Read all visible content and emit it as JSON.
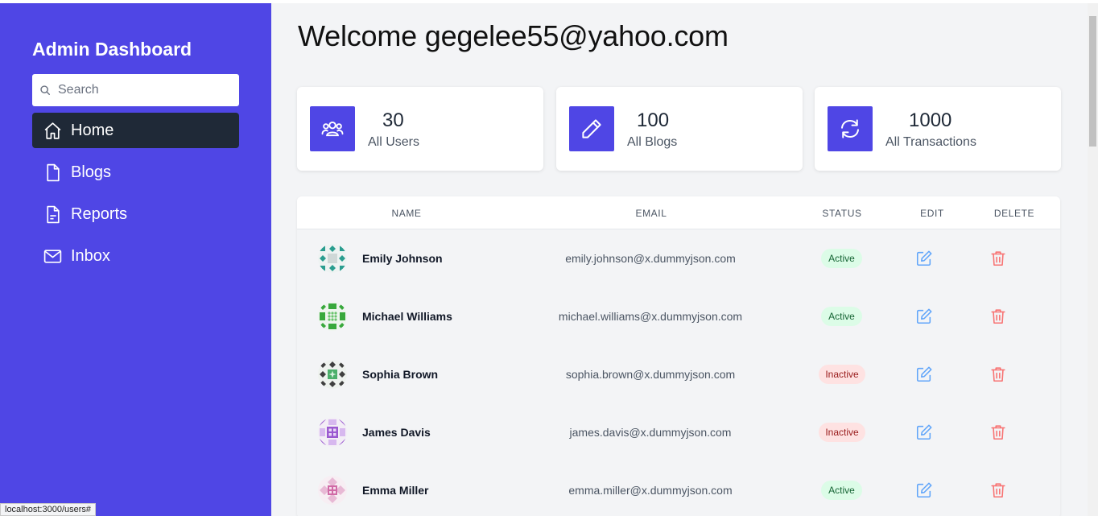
{
  "sidebar": {
    "title": "Admin Dashboard",
    "search_placeholder": "Search",
    "items": [
      {
        "label": "Home",
        "icon": "home-icon",
        "active": true
      },
      {
        "label": "Blogs",
        "icon": "document-icon",
        "active": false
      },
      {
        "label": "Reports",
        "icon": "report-icon",
        "active": false
      },
      {
        "label": "Inbox",
        "icon": "mail-icon",
        "active": false
      }
    ]
  },
  "main": {
    "welcome": "Welcome gegelee55@yahoo.com",
    "stats": [
      {
        "value": "30",
        "label": "All Users",
        "icon": "users-icon"
      },
      {
        "value": "100",
        "label": "All Blogs",
        "icon": "pencil-icon"
      },
      {
        "value": "1000",
        "label": "All Transactions",
        "icon": "refresh-icon"
      }
    ],
    "table": {
      "headers": [
        "NAME",
        "EMAIL",
        "STATUS",
        "EDIT",
        "DELETE"
      ],
      "rows": [
        {
          "name": "Emily Johnson",
          "email": "emily.johnson@x.dummyjson.com",
          "status": "Active"
        },
        {
          "name": "Michael Williams",
          "email": "michael.williams@x.dummyjson.com",
          "status": "Active"
        },
        {
          "name": "Sophia Brown",
          "email": "sophia.brown@x.dummyjson.com",
          "status": "Inactive"
        },
        {
          "name": "James Davis",
          "email": "james.davis@x.dummyjson.com",
          "status": "Inactive"
        },
        {
          "name": "Emma Miller",
          "email": "emma.miller@x.dummyjson.com",
          "status": "Active"
        }
      ]
    }
  },
  "colors": {
    "sidebar": "#4f46e5",
    "active_nav": "#1f2937",
    "edit_icon": "#60a5fa",
    "delete_icon": "#f87171",
    "avatar_colors": [
      "#2a9d8f",
      "#38a83c",
      "#3f3f3f",
      "#9b59d0",
      "#d06aa6"
    ]
  },
  "status_bar": {
    "url": "localhost:3000/users#"
  }
}
